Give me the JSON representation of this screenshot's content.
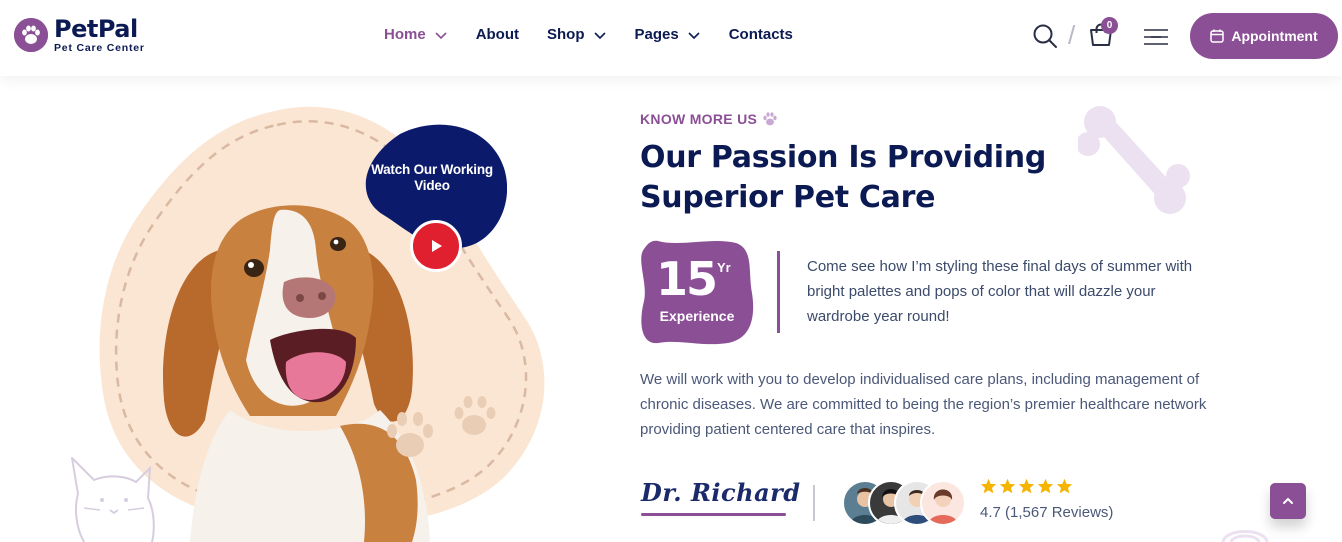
{
  "brand": {
    "name_a": "Pet",
    "name_b": "Pal",
    "tagline": "Pet Care Center",
    "color": "#8b4f96",
    "navy": "#0b1a52"
  },
  "nav": {
    "items": [
      {
        "label": "Home",
        "active": true,
        "has_dropdown": true
      },
      {
        "label": "About",
        "active": false,
        "has_dropdown": false
      },
      {
        "label": "Shop",
        "active": false,
        "has_dropdown": true
      },
      {
        "label": "Pages",
        "active": false,
        "has_dropdown": true
      },
      {
        "label": "Contacts",
        "active": false,
        "has_dropdown": false
      }
    ]
  },
  "header_actions": {
    "search_icon": "search-icon",
    "cart_icon": "cart-icon",
    "cart_count": "0",
    "menu_icon": "hamburger-icon",
    "appointment_label": "Appointment",
    "appointment_icon": "calendar-icon"
  },
  "video": {
    "label": "Watch Our Working Video",
    "play_icon": "play-icon"
  },
  "about": {
    "eyebrow": "KNOW MORE US",
    "headline": "Our Passion Is Providing Superior Pet Care",
    "experience_number": "15",
    "experience_unit": "Yr",
    "experience_label": "Experience",
    "experience_text": "Come see how I’m styling these final days of summer with bright palettes and pops of color that will dazzle your wardrobe year round!",
    "body": "We will work with you to develop individualised care plans, including management of chronic diseases. We are committed to being the region’s premier healthcare network providing patient centered care that inspires.",
    "signature": "Dr. Richard",
    "stars": 5,
    "rating_text": "4.7 (1,567 Reviews)"
  },
  "scroll_top_icon": "chevron-up-icon"
}
